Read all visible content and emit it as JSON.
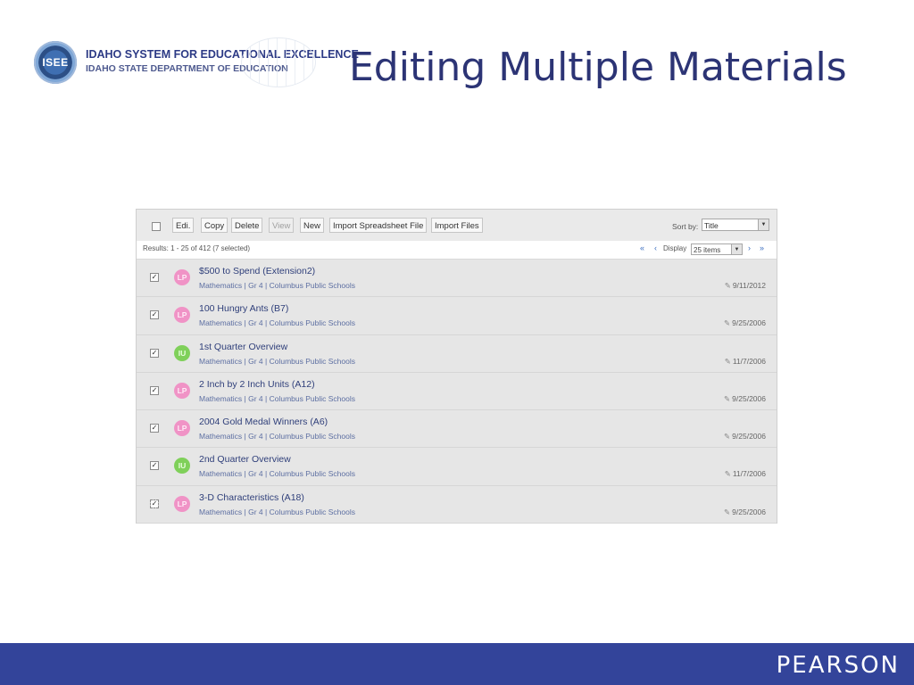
{
  "logo": {
    "seal_text": "ISEE",
    "line1": "IDAHO SYSTEM FOR EDUCATIONAL EXCELLENCE",
    "line2": "IDAHO STATE DEPARTMENT OF EDUCATION"
  },
  "slide_title": "Editing Multiple Materials",
  "toolbar": {
    "buttons": [
      {
        "label": "Edi.",
        "enabled": true
      },
      {
        "label": "Copy",
        "enabled": true
      },
      {
        "label": "Delete",
        "enabled": true
      },
      {
        "label": "View",
        "enabled": false
      },
      {
        "label": "New",
        "enabled": true
      },
      {
        "label": "Import Spreadsheet File",
        "enabled": true
      },
      {
        "label": "Import Files",
        "enabled": true
      }
    ],
    "sort_label": "Sort by:",
    "sort_value": "Title"
  },
  "results": {
    "text": "Results: 1 - 25 of 412 (7 selected)",
    "display_label": "Display",
    "display_value": "25 items",
    "pager": {
      "first": "«",
      "prev": "‹",
      "next": "›",
      "last": "»"
    }
  },
  "rows": [
    {
      "checked": true,
      "badge": "LP",
      "title": "$500 to Spend (Extension2)",
      "subject": "Mathematics",
      "grade": "Gr 4",
      "district": "Columbus Public Schools",
      "date": "9/11/2012"
    },
    {
      "checked": true,
      "badge": "LP",
      "title": "100 Hungry Ants (B7)",
      "subject": "Mathematics",
      "grade": "Gr 4",
      "district": "Columbus Public Schools",
      "date": "9/25/2006"
    },
    {
      "checked": true,
      "badge": "IU",
      "title": "1st Quarter Overview",
      "subject": "Mathematics",
      "grade": "Gr 4",
      "district": "Columbus Public Schools",
      "date": "11/7/2006"
    },
    {
      "checked": true,
      "badge": "LP",
      "title": "2 Inch by 2 Inch Units (A12)",
      "subject": "Mathematics",
      "grade": "Gr 4",
      "district": "Columbus Public Schools",
      "date": "9/25/2006"
    },
    {
      "checked": true,
      "badge": "LP",
      "title": "2004 Gold Medal Winners (A6)",
      "subject": "Mathematics",
      "grade": "Gr 4",
      "district": "Columbus Public Schools",
      "date": "9/25/2006"
    },
    {
      "checked": true,
      "badge": "IU",
      "title": "2nd Quarter Overview",
      "subject": "Mathematics",
      "grade": "Gr 4",
      "district": "Columbus Public Schools",
      "date": "11/7/2006"
    },
    {
      "checked": true,
      "badge": "LP",
      "title": "3-D Characteristics (A18)",
      "subject": "Mathematics",
      "grade": "Gr 4",
      "district": "Columbus Public Schools",
      "date": "9/25/2006"
    }
  ],
  "footer": {
    "brand": "PEARSON"
  },
  "colors": {
    "title": "#2c3475",
    "footer": "#33449a",
    "badge_lp": "#f093c6",
    "badge_iu": "#7fd05a",
    "link": "#3d6fc0"
  }
}
